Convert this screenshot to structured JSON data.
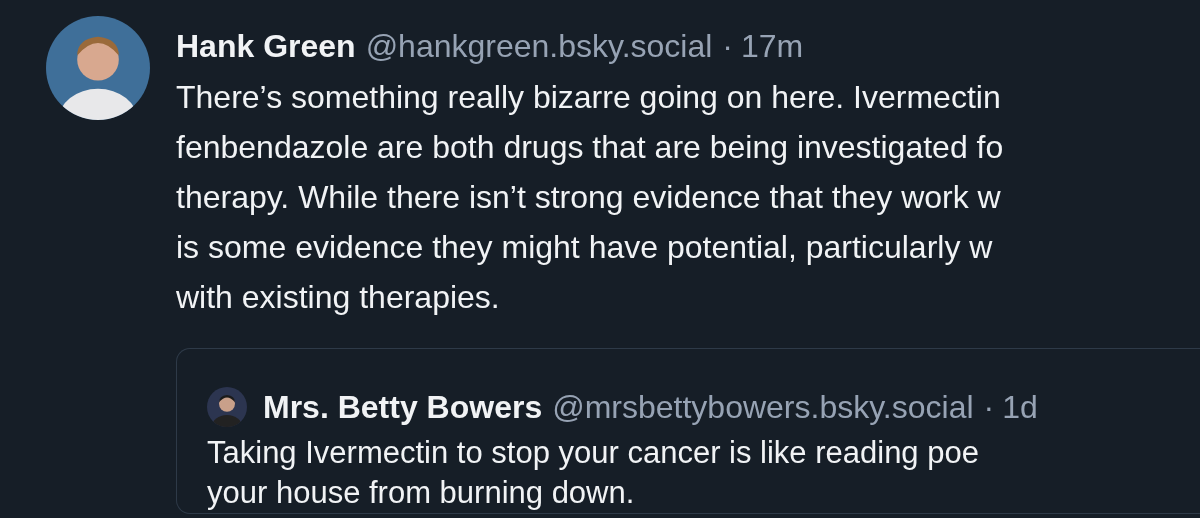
{
  "post": {
    "author": {
      "name": "Hank Green",
      "handle": "@hankgreen.bsky.social",
      "separator": "·",
      "time": "17m"
    },
    "lines": [
      "There’s something really bizarre going on here. Ivermectin",
      "fenbendazole are both drugs that are being investigated fo",
      "therapy. While there isn’t strong evidence that they work w",
      "is some evidence they might have potential, particularly w",
      "with existing therapies."
    ],
    "quote": {
      "author": {
        "name": "Mrs. Betty Bowers",
        "handle": "@mrsbettybowers.bsky.social",
        "separator": "·",
        "time": "1d"
      },
      "lines": [
        "Taking Ivermectin to stop your cancer is like reading poe",
        "your house from burning down."
      ]
    }
  }
}
